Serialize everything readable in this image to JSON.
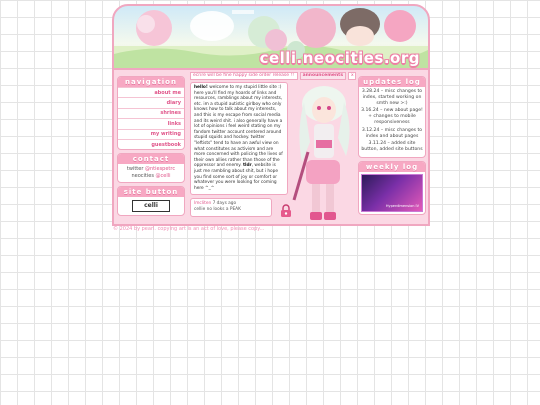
{
  "banner": {
    "title": "celli.neocities.org"
  },
  "nav": {
    "heading": "navigation",
    "items": [
      {
        "label": "about me"
      },
      {
        "label": "diary"
      },
      {
        "label": "shrines"
      },
      {
        "label": "links"
      },
      {
        "label": "my writing"
      },
      {
        "label": "guestbook"
      }
    ]
  },
  "contact": {
    "heading": "contact",
    "twitter_label": "twitter",
    "twitter_handle": "@ntiespetrc",
    "neocities_label": "neocities",
    "neocities_handle": "@celli"
  },
  "site_button": {
    "heading": "site button",
    "label": "celli"
  },
  "tabs": {
    "marquee": "ecrire will be fine   happy side order release !!",
    "announcements": "announcements",
    "close": "x"
  },
  "welcome": {
    "greeting": "hello!",
    "body": " welcome to my stupid little site :) here you'll find my hoards of links and resources, ramblings about my interests, etc. im a stupid autistic girlboy who only knows how to talk about my interests, and this is my escape from social media and its weird shit. i also generally have a lot of opinions i feel weird stating on my fandom twitter account centered around stupid squids and hockey. twitter \"leftists\" tend to have an awful view on what constitutes as activism and are more concerned with policing the lives of their own allies rather than those of the oppressor and enemy. ",
    "emphasis": "tldr",
    "closing": ", website is just me rambling about shit, but i hope you find some sort of joy or comfort or whatever you were looking for coming here ^_^"
  },
  "status": {
    "name": "lmcliten",
    "time": "7 days ago",
    "text": "cellie no looks a PEAK"
  },
  "updates": {
    "heading": "updates log",
    "entries": [
      {
        "text": "3.28.24 – misc changes to index, started working on smth new >:)"
      },
      {
        "text": "3.16.24 – new about page! + changes to mobile responsiveness"
      },
      {
        "text": "3.12.24 – misc changes to index and about pages"
      },
      {
        "text": "3.11.24 – added site button, added site buttons"
      }
    ]
  },
  "weekly": {
    "heading": "weekly log",
    "caption": "Hyperdimension IV"
  },
  "footer": {
    "text": "© 2024 by pearl. copying art is an act of love, please copy..."
  },
  "colors": {
    "accent": "#f0a7c0",
    "link": "#e0558a",
    "frame": "#fbd8e4"
  }
}
